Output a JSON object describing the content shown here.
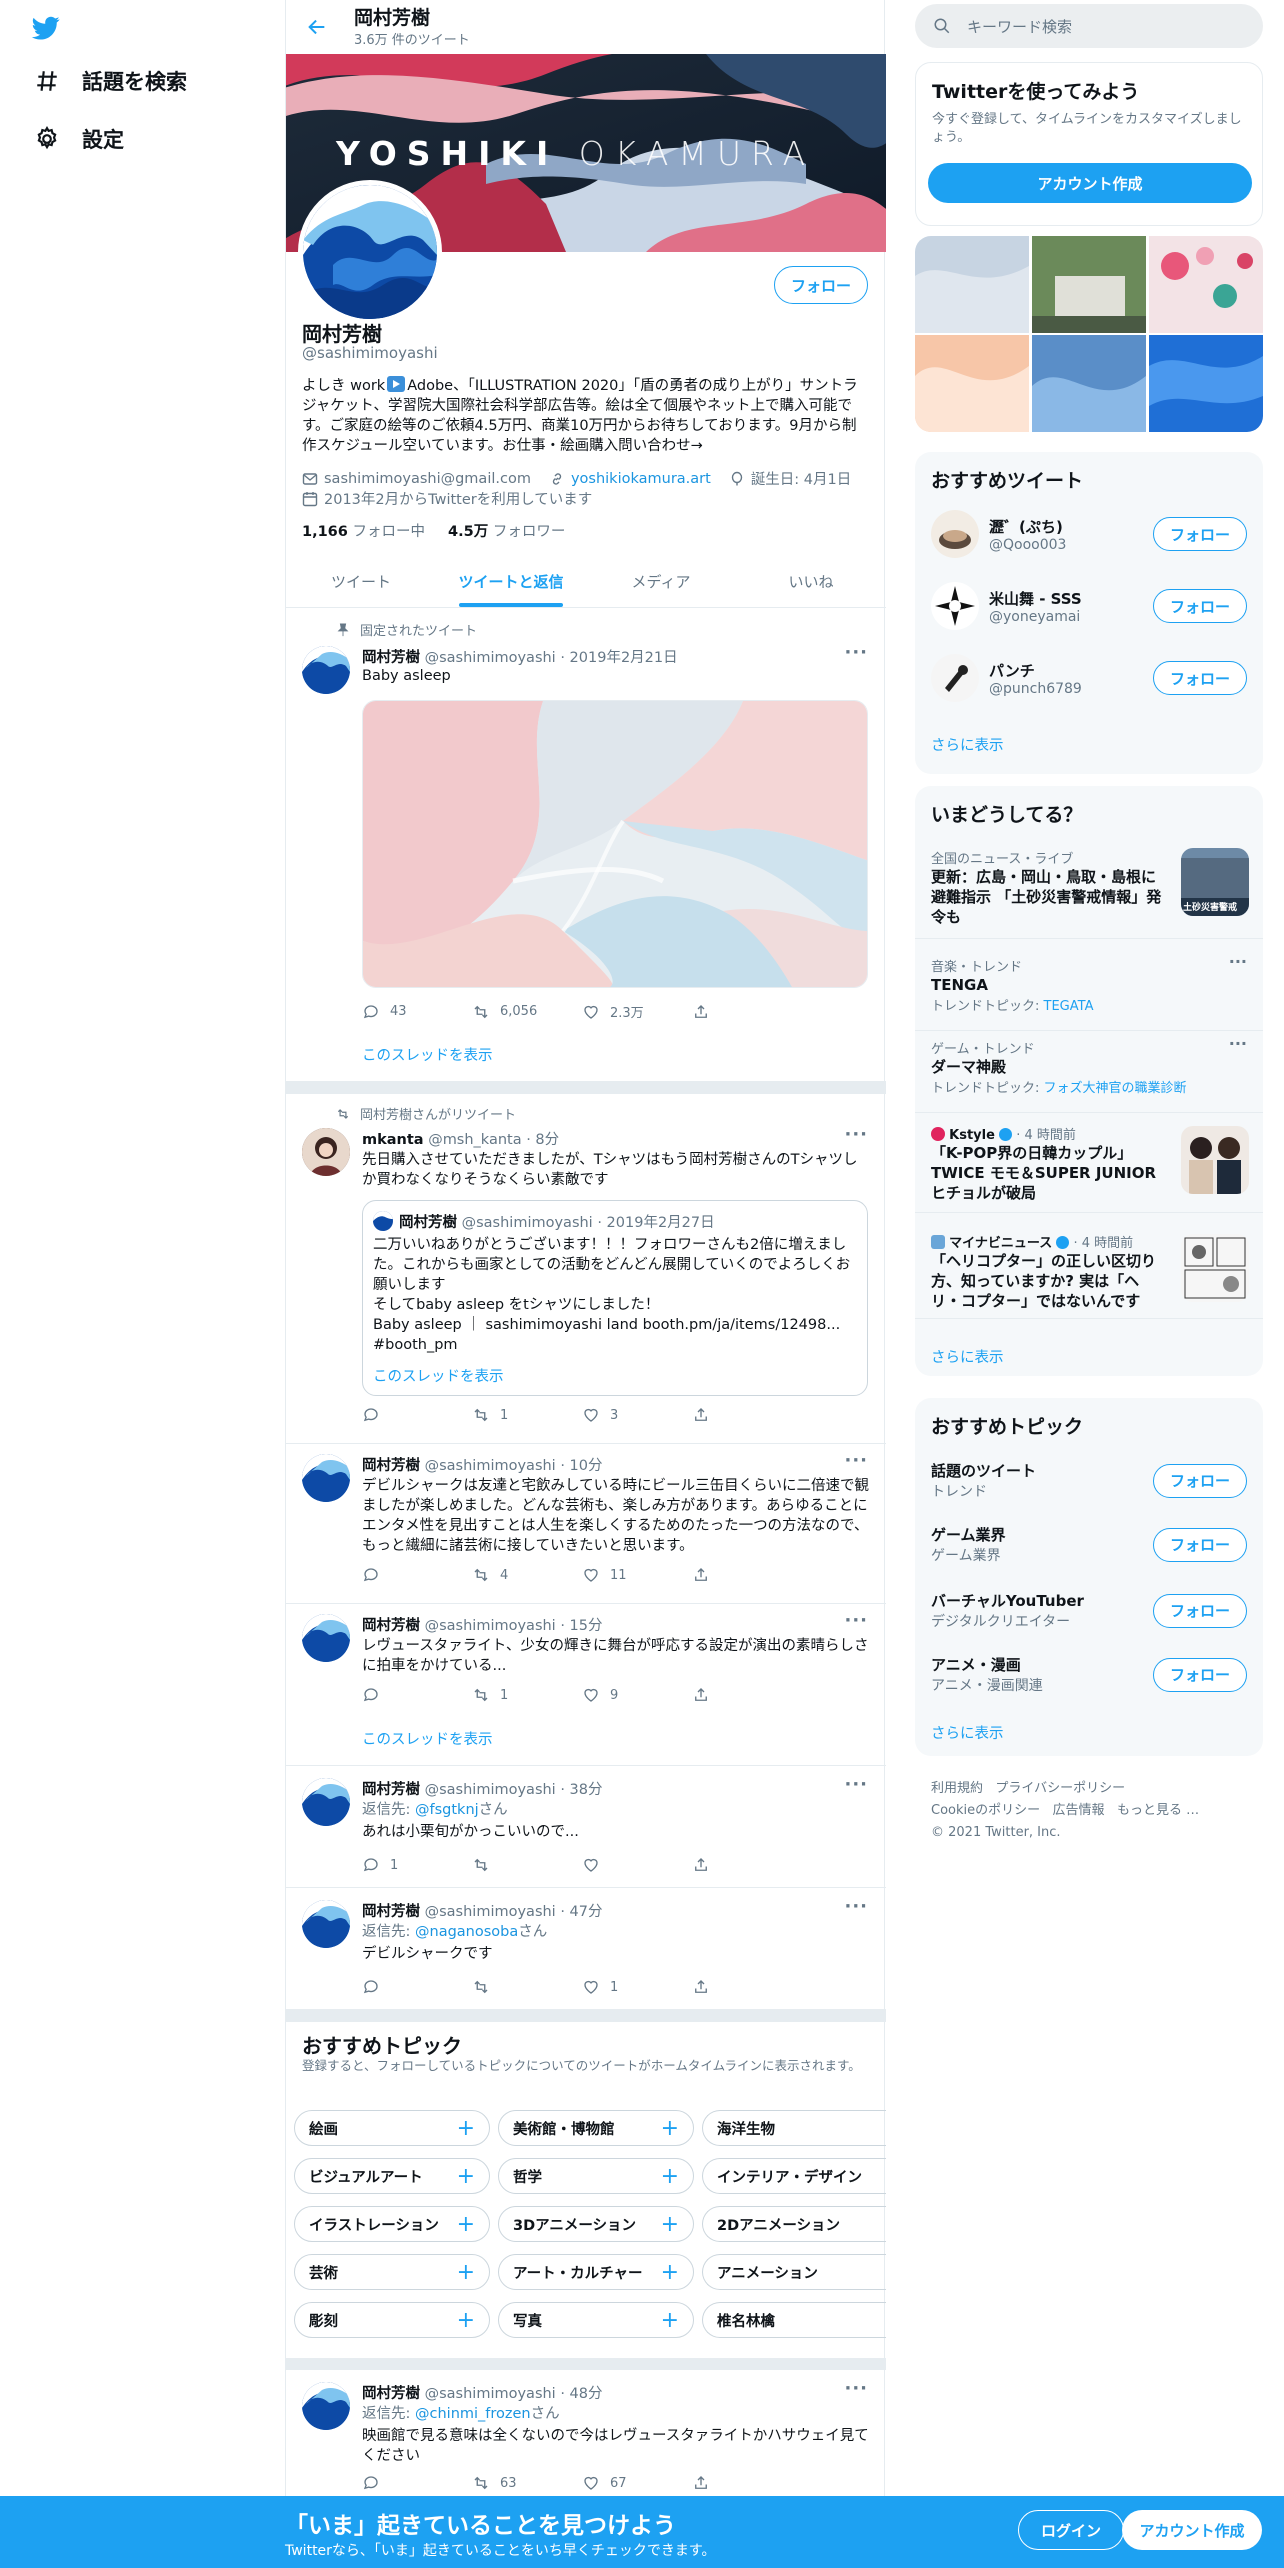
{
  "nav": {
    "explore": "話題を検索",
    "settings": "設定"
  },
  "header": {
    "title": "岡村芳樹",
    "subtitle": "3.6万 件のツイート"
  },
  "banner": {
    "word1": "YOSHIKI",
    "word2": "OKAMURA"
  },
  "profile": {
    "name": "岡村芳樹",
    "handle": "@sashimimoyashi",
    "follow": "フォロー",
    "bio_1": "よしき work",
    "bio_2": "Adobe、「ILLUSTRATION 2020」「盾の勇者の成り上がり」サントラジャケット、学習院大国際社会科学部広告等。絵は全て個展やネット上で購入可能です。ご家庭の絵等のご依頼4.5万円、商業10万円からお待ちしております。9月から制作スケジュール空いています。お仕事・絵画購入問い合わせ→",
    "email": "sashimimoyashi@gmail.com",
    "website": "yoshikiokamura.art",
    "birthday": "誕生日: 4月1日",
    "joined": "2013年2月からTwitterを利用しています",
    "following_count": "1,166",
    "following_label": "フォロー中",
    "followers_count": "4.5万",
    "followers_label": "フォロワー"
  },
  "tabs": [
    "ツイート",
    "ツイートと返信",
    "メディア",
    "いいね"
  ],
  "tweets": [
    {
      "context": "固定されたツイート",
      "name": "岡村芳樹",
      "meta": "@sashimimoyashi · 2019年2月21日",
      "text": "Baby asleep",
      "reply": "43",
      "rt": "6,056",
      "like": "2.3万",
      "thread": "このスレッドを表示"
    },
    {
      "context": "岡村芳樹さんがリツイート",
      "name": "mkanta",
      "meta": "@msh_kanta · 8分",
      "text": "先日購入させていただきましたが、Tシャツはもう岡村芳樹さんのTシャツしか買わなくなりそうなくらい素敵です",
      "reply": "",
      "rt": "1",
      "like": "3",
      "quote": {
        "name": "岡村芳樹",
        "meta": "@sashimimoyashi · 2019年2月27日",
        "text1": "二万いいねありがとうございます！！！フォロワーさんも2倍に増えました。これからも画家としての活動をどんどん展開していくのでよろしくお願いします",
        "text2": "そしてbaby asleep をtシャツにしました！",
        "text3": "Baby asleep ｜ sashimimoyashi land booth.pm/ja/items/12498...",
        "text4": "#booth_pm",
        "thread": "このスレッドを表示"
      }
    },
    {
      "name": "岡村芳樹",
      "meta": "@sashimimoyashi · 10分",
      "text": "デビルシャークは友達と宅飲みしている時にビール三缶目くらいに二倍速で観ましたが楽しめました。どんな芸術も、楽しみ方があります。あらゆることにエンタメ性を見出すことは人生を楽しくするためのたった一つの方法なので、もっと繊細に諸芸術に接していきたいと思います。",
      "reply": "",
      "rt": "4",
      "like": "11"
    },
    {
      "name": "岡村芳樹",
      "meta": "@sashimimoyashi · 15分",
      "text": "レヴュースタァライト、少女の輝きに舞台が呼応する設定が演出の素晴らしさに拍車をかけている...",
      "reply": "",
      "rt": "1",
      "like": "9",
      "thread": "このスレッドを表示"
    },
    {
      "name": "岡村芳樹",
      "meta": "@sashimimoyashi · 38分",
      "reply_to": "返信先:",
      "reply_handle": "@fsgtknj",
      "reply_suffix": "さん",
      "text": "あれは小栗旬がかっこいいので...",
      "reply": "1",
      "rt": "",
      "like": ""
    },
    {
      "name": "岡村芳樹",
      "meta": "@sashimimoyashi · 47分",
      "reply_to": "返信先:",
      "reply_handle": "@naganosoba",
      "reply_suffix": "さん",
      "text": "デビルシャークです",
      "reply": "",
      "rt": "",
      "like": "1"
    },
    {
      "name": "岡村芳樹",
      "meta": "@sashimimoyashi · 48分",
      "reply_to": "返信先:",
      "reply_handle": "@chinmi_frozen",
      "reply_suffix": "さん",
      "text": "映画館で見る意味は全くないので今はレヴュースタァライトかハサウェイ見てください",
      "reply": "",
      "rt": "63",
      "like": "67"
    }
  ],
  "center_topics": {
    "title": "おすすめトピック",
    "desc": "登録すると、フォローしているトピックについてのツイートがホームタイムラインに表示されます。",
    "chips": [
      "絵画",
      "美術館・博物館",
      "海洋生物",
      "ビジュアルアート",
      "哲学",
      "インテリア・デザイン",
      "イラストレーション",
      "3Dアニメーション",
      "2Dアニメーション",
      "芸術",
      "アート・カルチャー",
      "アニメーション",
      "彫刻",
      "写真",
      "椎名林檎"
    ]
  },
  "right": {
    "search_placeholder": "キーワード検索",
    "join": {
      "title": "Twitterを使ってみよう",
      "desc": "今すぐ登録して、タイムラインをカスタマイズしましょう。",
      "button": "アカウント作成"
    },
    "rec": {
      "title": "おすすめツイート",
      "follow": "フォロー",
      "more": "さらに表示",
      "users": [
        {
          "name": "瀝゛(ぷち)",
          "handle": "@Qooo003"
        },
        {
          "name": "米山舞 - SSS",
          "handle": "@yoneyamai"
        },
        {
          "name": "パンチ",
          "handle": "@punch6789"
        }
      ]
    },
    "trends": {
      "title": "いまどうしてる？",
      "more": "さらに表示",
      "items": [
        {
          "cat": "全国のニュース・ライブ",
          "title": "更新：広島・岡山・鳥取・島根に避難指示 「土砂災害警戒情報」発令も",
          "img_text": "土砂災害警戒"
        },
        {
          "cat": "音楽・トレンド",
          "title": "TENGA",
          "sub_prefix": "トレンドトピック:",
          "sub_link": "TEGATA"
        },
        {
          "cat": "ゲーム・トレンド",
          "title": "ダーマ神殿",
          "sub_prefix": "トレンドトピック:",
          "sub_link": "フォズ大神官の職業診断"
        },
        {
          "cat": "Kstyle",
          "time": "· 4 時間前",
          "title": "「K-POP界の日韓カップル」TWICE モモ＆SUPER JUNIOR ヒチョルが破局"
        },
        {
          "cat": "マイナビニュース",
          "time": "· 4 時間前",
          "title": "「ヘリコプター」の正しい区切り方、知っていますか? 実は「ヘリ・コプター」ではないんです"
        }
      ]
    },
    "topics": {
      "title": "おすすめトピック",
      "follow": "フォロー",
      "more": "さらに表示",
      "items": [
        {
          "name": "話題のツイート",
          "sub": "トレンド"
        },
        {
          "name": "ゲーム業界",
          "sub": "ゲーム業界"
        },
        {
          "name": "バーチャルYouTuber",
          "sub": "デジタルクリエイター"
        },
        {
          "name": "アニメ・漫画",
          "sub": "アニメ・漫画関連"
        }
      ]
    },
    "footer": {
      "l1": "利用規約",
      "l2": "プライバシーポリシー",
      "l3": "Cookieのポリシー",
      "l4": "広告情報",
      "l5": "もっと見る …",
      "copy": "© 2021 Twitter, Inc."
    }
  },
  "bottom": {
    "title": "「いま」起きていることを見つけよう",
    "sub": "Twitterなら、「いま」起きていることをいち早くチェックできます。",
    "login": "ログイン",
    "signup": "アカウント作成"
  },
  "colors": {
    "accent": "#1da1f2",
    "bg_gray": "#f5f8fa",
    "border": "#e6ecf0"
  }
}
